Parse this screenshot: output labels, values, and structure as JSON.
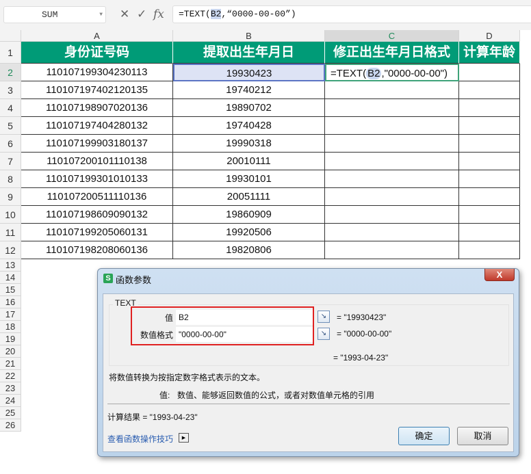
{
  "formula_bar": {
    "name_box": "SUM",
    "cancel_icon": "✕",
    "confirm_icon": "✓",
    "fx_label": "fx",
    "formula_prefix": "=TEXT(",
    "formula_ref": "B2",
    "formula_suffix": ",“0000-00-00”)"
  },
  "columns": [
    "A",
    "B",
    "C",
    "D"
  ],
  "headers": [
    "身份证号码",
    "提取出生年月日",
    "修正出生年月日格式",
    "计算年龄"
  ],
  "rows": [
    {
      "n": "2",
      "a": "110107199304230113",
      "b": "19930423",
      "c": ""
    },
    {
      "n": "3",
      "a": "110107197402120135",
      "b": "19740212",
      "c": ""
    },
    {
      "n": "4",
      "a": "110107198907020136",
      "b": "19890702",
      "c": ""
    },
    {
      "n": "5",
      "a": "110107197404280132",
      "b": "19740428",
      "c": ""
    },
    {
      "n": "6",
      "a": "110107199903180137",
      "b": "19990318",
      "c": ""
    },
    {
      "n": "7",
      "a": "110107200101110138",
      "b": "20010111",
      "c": ""
    },
    {
      "n": "8",
      "a": "110107199301010133",
      "b": "19930101",
      "c": ""
    },
    {
      "n": "9",
      "a": "110107200511110136",
      "b": "20051111",
      "c": ""
    },
    {
      "n": "10",
      "a": "110107198609090132",
      "b": "19860909",
      "c": ""
    },
    {
      "n": "11",
      "a": "110107199205060131",
      "b": "19920506",
      "c": ""
    },
    {
      "n": "12",
      "a": "110107198208060136",
      "b": "19820806",
      "c": ""
    }
  ],
  "edit_cell": {
    "prefix": "=TEXT(",
    "ref": "B2",
    "suffix": ",\"0000-00-00\")"
  },
  "empty_rows": [
    "13",
    "14",
    "15",
    "16",
    "17",
    "18",
    "19",
    "20",
    "21",
    "22",
    "23",
    "24",
    "25",
    "26"
  ],
  "row1_label": "1",
  "dialog": {
    "title": "函数参数",
    "logo": "S",
    "close": "X",
    "function_name": "TEXT",
    "arg1_label": "值",
    "arg1_value": "B2",
    "arg1_result": "=  \"19930423\"",
    "arg2_label": "数值格式",
    "arg2_value": "\"0000-00-00\"",
    "arg2_result": "=  \"0000-00-00\"",
    "formula_result": "=  \"1993-04-23\"",
    "description": "将数值转换为按指定数字格式表示的文本。",
    "arg_help_label": "值:",
    "arg_help": "数值、能够返回数值的公式，或者对数值单元格的引用",
    "calc_result": "计算结果  =  \"1993-04-23\"",
    "help_link": "查看函数操作技巧",
    "ok": "确定",
    "cancel": "取消"
  },
  "colors": {
    "header_green": "#009b77",
    "highlight": "#e02020"
  }
}
